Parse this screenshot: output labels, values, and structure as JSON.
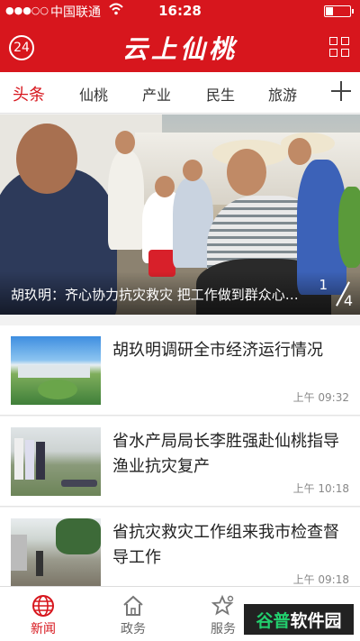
{
  "status_bar": {
    "signal": "●●●○○",
    "carrier": "中国联通",
    "time": "16:28"
  },
  "header": {
    "weather_badge": "24",
    "logo_text": "云上仙桃"
  },
  "tabs": [
    {
      "label": "头条",
      "active": true
    },
    {
      "label": "仙桃",
      "active": false
    },
    {
      "label": "产业",
      "active": false
    },
    {
      "label": "民生",
      "active": false
    },
    {
      "label": "旅游",
      "active": false
    }
  ],
  "hero": {
    "caption": "胡玖明：齐心协力抗灾救灾 把工作做到群众心坎上",
    "page_current": "1",
    "page_total": "4"
  },
  "news": [
    {
      "title": "胡玖明调研全市经济运行情况",
      "time": "上午 09:32"
    },
    {
      "title": "省水产局局长李胜强赴仙桃指导渔业抗灾复产",
      "time": "上午 10:18"
    },
    {
      "title": "省抗灾救灾工作组来我市检查督导工作",
      "time": "上午 09:18"
    }
  ],
  "bottom_nav": [
    {
      "label": "新闻",
      "icon": "globe-icon",
      "active": true
    },
    {
      "label": "政务",
      "icon": "home-icon",
      "active": false
    },
    {
      "label": "服务",
      "icon": "star-icon",
      "active": false
    }
  ],
  "watermark": {
    "brand_green": "谷普",
    "brand_white": "软件园"
  },
  "colors": {
    "brand": "#d7161d",
    "text": "#222222",
    "muted": "#888888"
  }
}
